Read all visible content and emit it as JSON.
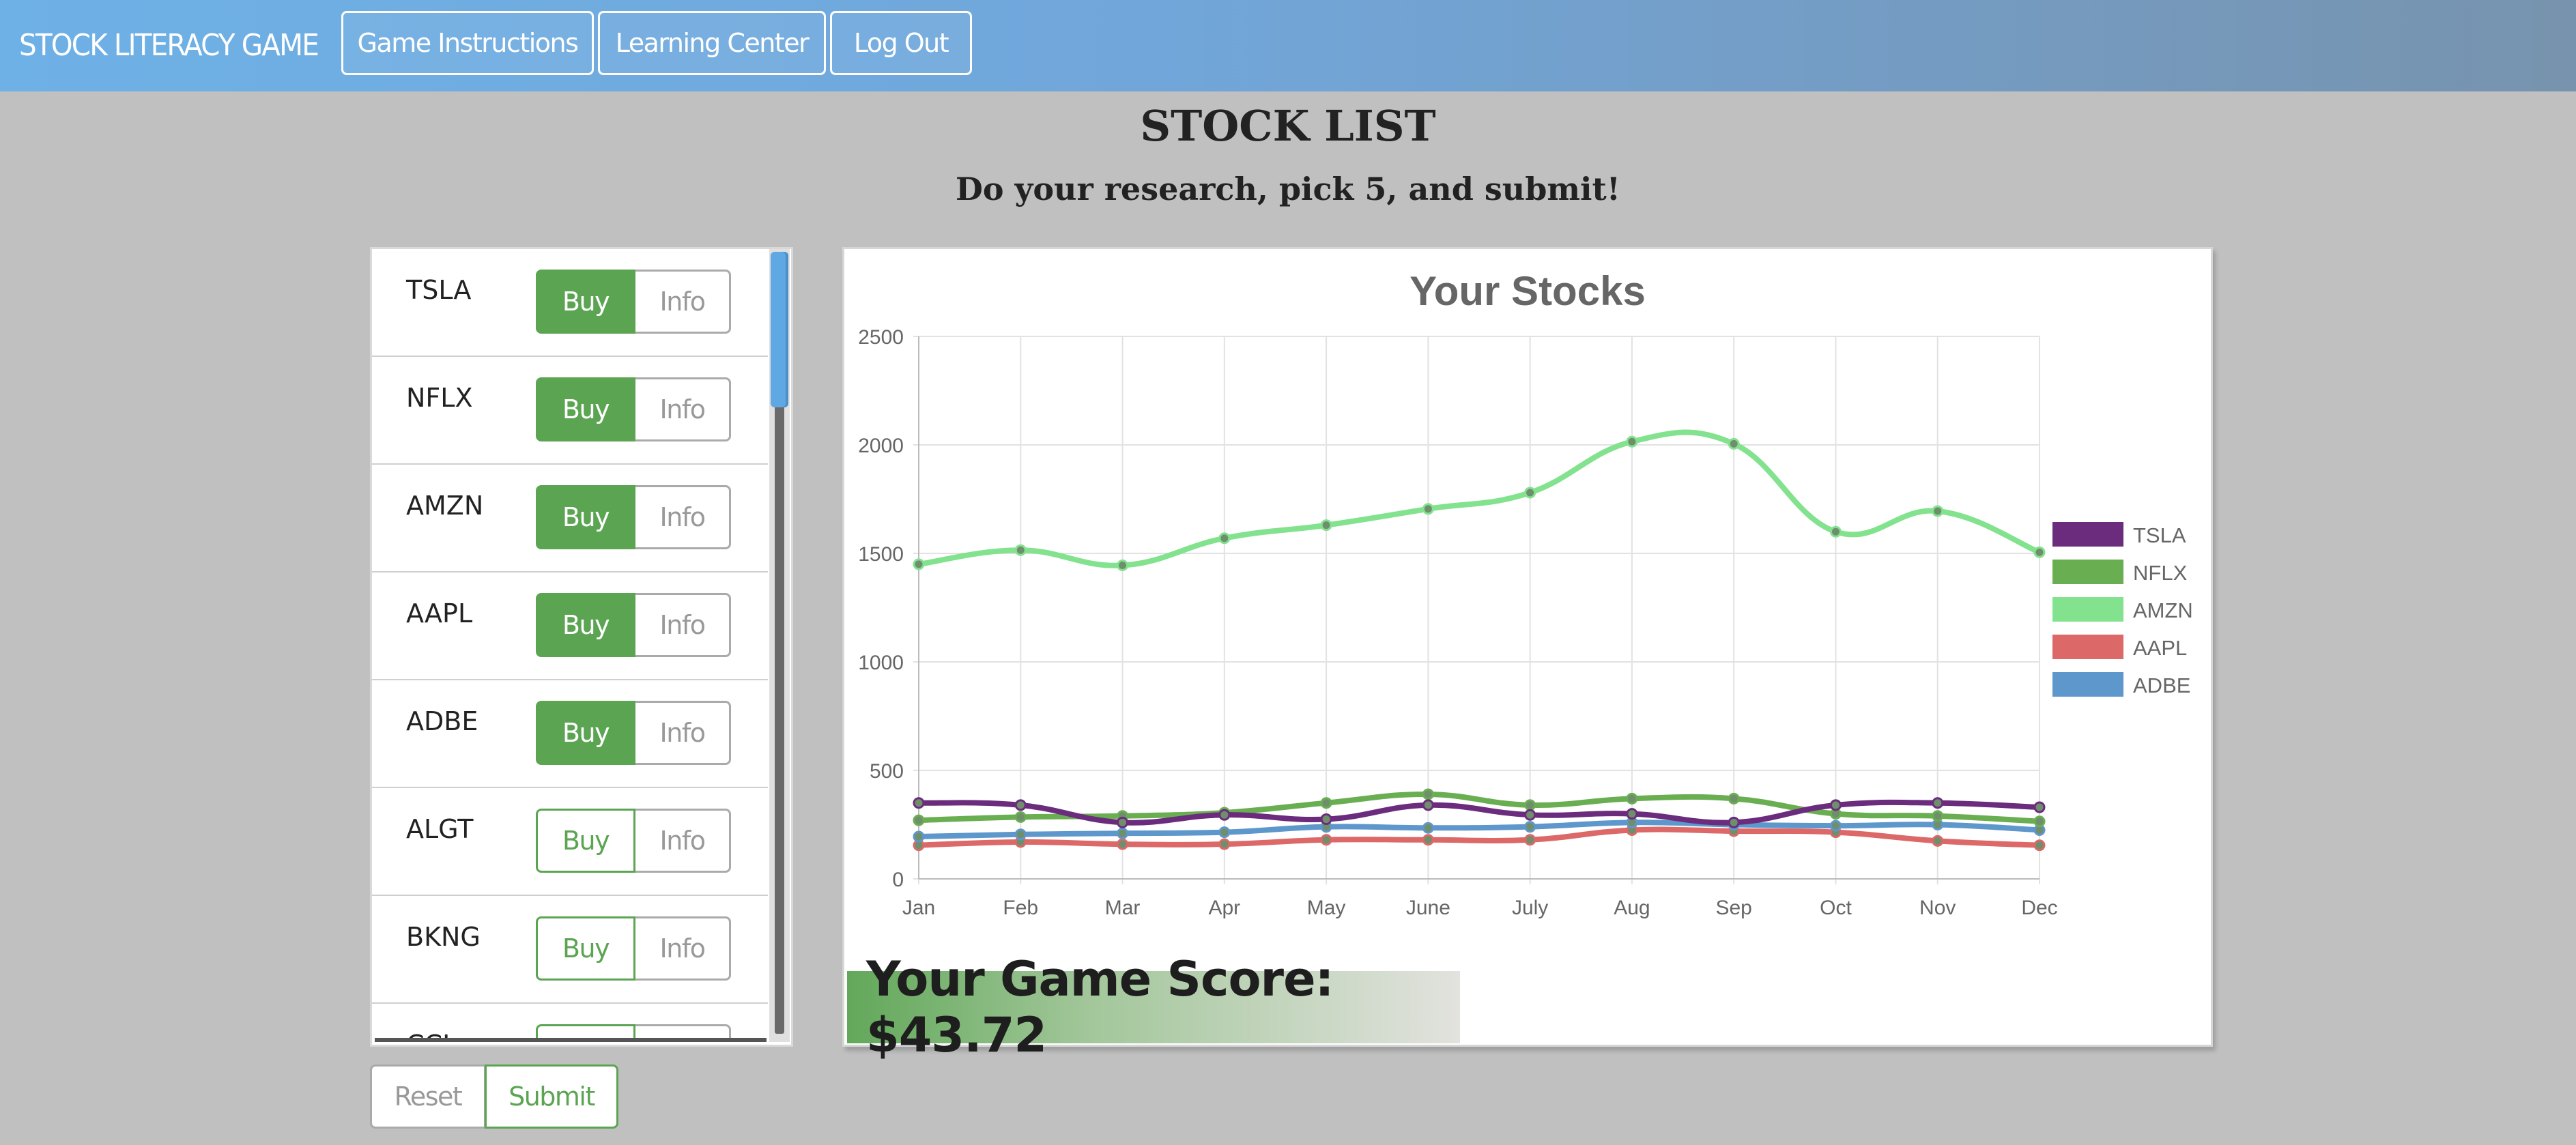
{
  "navbar": {
    "brand": "STOCK LITERACY GAME",
    "items": [
      {
        "label": "Game Instructions"
      },
      {
        "label": "Learning Center"
      },
      {
        "label": "Log Out"
      }
    ]
  },
  "header": {
    "title": "STOCK LIST",
    "subtitle": "Do your research, pick 5, and submit!"
  },
  "stock_list": {
    "buy_label": "Buy",
    "info_label": "Info",
    "items": [
      {
        "ticker": "TSLA",
        "selected": true
      },
      {
        "ticker": "NFLX",
        "selected": true
      },
      {
        "ticker": "AMZN",
        "selected": true
      },
      {
        "ticker": "AAPL",
        "selected": true
      },
      {
        "ticker": "ADBE",
        "selected": true
      },
      {
        "ticker": "ALGT",
        "selected": false
      },
      {
        "ticker": "BKNG",
        "selected": false
      },
      {
        "ticker": "CCL",
        "selected": false
      }
    ]
  },
  "actions": {
    "reset_label": "Reset",
    "submit_label": "Submit"
  },
  "score": {
    "text": "Your Game Score: $43.72"
  },
  "colors": {
    "accent_green": "#5ba552",
    "nav_blue": "#6eb1e6"
  },
  "chart_data": {
    "type": "line",
    "title": "Your Stocks",
    "categories": [
      "Jan",
      "Feb",
      "Mar",
      "Apr",
      "May",
      "June",
      "July",
      "Aug",
      "Sep",
      "Oct",
      "Nov",
      "Dec"
    ],
    "ylim": [
      0,
      2500
    ],
    "yticks": [
      0,
      500,
      1000,
      1500,
      2000,
      2500
    ],
    "grid": true,
    "legend_position": "right",
    "series": [
      {
        "name": "TSLA",
        "color": "#6b2c7d",
        "values": [
          350,
          340,
          260,
          295,
          275,
          340,
          295,
          300,
          260,
          340,
          350,
          330
        ]
      },
      {
        "name": "NFLX",
        "color": "#6aae52",
        "values": [
          270,
          285,
          290,
          305,
          350,
          390,
          340,
          370,
          370,
          300,
          290,
          265
        ]
      },
      {
        "name": "AMZN",
        "color": "#82e28e",
        "values": [
          1450,
          1515,
          1445,
          1570,
          1630,
          1705,
          1780,
          2015,
          2005,
          1600,
          1695,
          1505
        ]
      },
      {
        "name": "AAPL",
        "color": "#dc6868",
        "values": [
          155,
          170,
          160,
          160,
          180,
          180,
          180,
          225,
          220,
          215,
          175,
          155
        ]
      },
      {
        "name": "ADBE",
        "color": "#5e97cc",
        "values": [
          195,
          205,
          210,
          215,
          240,
          235,
          240,
          260,
          250,
          245,
          250,
          225
        ]
      }
    ]
  }
}
